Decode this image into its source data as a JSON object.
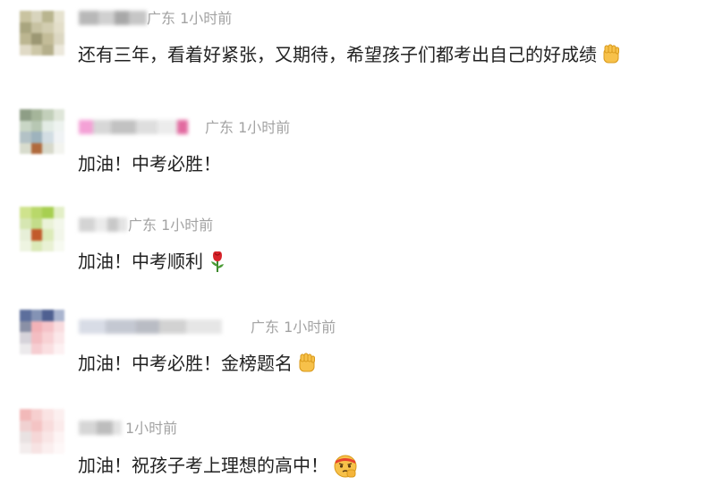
{
  "comments": [
    {
      "region": "广东",
      "time": "1小时前",
      "text": "还有三年，看着好紧张，又期待，希望孩子们都考出自己的好成绩",
      "emoji": "fist-emoji"
    },
    {
      "region": "广东",
      "time": "1小时前",
      "text": "加油！中考必胜！",
      "emoji": ""
    },
    {
      "region": "广东",
      "time": "1小时前",
      "text": "加油！中考顺利",
      "emoji": "rose-emoji"
    },
    {
      "region": "广东",
      "time": "1小时前",
      "text": "加油！中考必胜！金榜题名",
      "emoji": "fist-emoji"
    },
    {
      "region": "",
      "time": "1小时前",
      "text": "加油！祝孩子考上理想的高中！",
      "emoji": "determined-face-emoji"
    }
  ]
}
